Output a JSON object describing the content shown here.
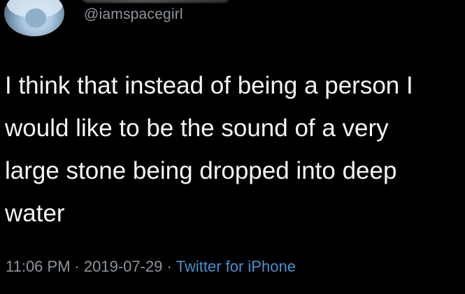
{
  "user": {
    "handle": "@iamspacegirl"
  },
  "tweet": {
    "lines": [
      "I think that instead of being a person I",
      "would like to be the sound of a very",
      "large stone being dropped into deep",
      "water"
    ],
    "time": "11:06 PM",
    "date": "2019-07-29",
    "separator": "·",
    "source": "Twitter for iPhone"
  },
  "colors": {
    "background": "#000000",
    "text": "#f5f5f5",
    "muted": "#8e959c",
    "link": "#4a90d0"
  }
}
